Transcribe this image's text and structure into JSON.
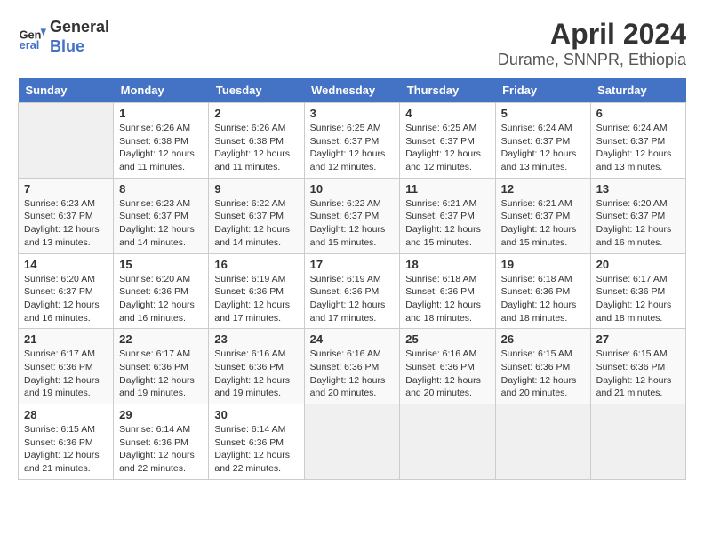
{
  "logo": {
    "line1": "General",
    "line2": "Blue"
  },
  "title": "April 2024",
  "subtitle": "Durame, SNNPR, Ethiopia",
  "days_of_week": [
    "Sunday",
    "Monday",
    "Tuesday",
    "Wednesday",
    "Thursday",
    "Friday",
    "Saturday"
  ],
  "weeks": [
    [
      {
        "num": "",
        "info": ""
      },
      {
        "num": "1",
        "info": "Sunrise: 6:26 AM\nSunset: 6:38 PM\nDaylight: 12 hours\nand 11 minutes."
      },
      {
        "num": "2",
        "info": "Sunrise: 6:26 AM\nSunset: 6:38 PM\nDaylight: 12 hours\nand 11 minutes."
      },
      {
        "num": "3",
        "info": "Sunrise: 6:25 AM\nSunset: 6:37 PM\nDaylight: 12 hours\nand 12 minutes."
      },
      {
        "num": "4",
        "info": "Sunrise: 6:25 AM\nSunset: 6:37 PM\nDaylight: 12 hours\nand 12 minutes."
      },
      {
        "num": "5",
        "info": "Sunrise: 6:24 AM\nSunset: 6:37 PM\nDaylight: 12 hours\nand 13 minutes."
      },
      {
        "num": "6",
        "info": "Sunrise: 6:24 AM\nSunset: 6:37 PM\nDaylight: 12 hours\nand 13 minutes."
      }
    ],
    [
      {
        "num": "7",
        "info": "Sunrise: 6:23 AM\nSunset: 6:37 PM\nDaylight: 12 hours\nand 13 minutes."
      },
      {
        "num": "8",
        "info": "Sunrise: 6:23 AM\nSunset: 6:37 PM\nDaylight: 12 hours\nand 14 minutes."
      },
      {
        "num": "9",
        "info": "Sunrise: 6:22 AM\nSunset: 6:37 PM\nDaylight: 12 hours\nand 14 minutes."
      },
      {
        "num": "10",
        "info": "Sunrise: 6:22 AM\nSunset: 6:37 PM\nDaylight: 12 hours\nand 15 minutes."
      },
      {
        "num": "11",
        "info": "Sunrise: 6:21 AM\nSunset: 6:37 PM\nDaylight: 12 hours\nand 15 minutes."
      },
      {
        "num": "12",
        "info": "Sunrise: 6:21 AM\nSunset: 6:37 PM\nDaylight: 12 hours\nand 15 minutes."
      },
      {
        "num": "13",
        "info": "Sunrise: 6:20 AM\nSunset: 6:37 PM\nDaylight: 12 hours\nand 16 minutes."
      }
    ],
    [
      {
        "num": "14",
        "info": "Sunrise: 6:20 AM\nSunset: 6:37 PM\nDaylight: 12 hours\nand 16 minutes."
      },
      {
        "num": "15",
        "info": "Sunrise: 6:20 AM\nSunset: 6:36 PM\nDaylight: 12 hours\nand 16 minutes."
      },
      {
        "num": "16",
        "info": "Sunrise: 6:19 AM\nSunset: 6:36 PM\nDaylight: 12 hours\nand 17 minutes."
      },
      {
        "num": "17",
        "info": "Sunrise: 6:19 AM\nSunset: 6:36 PM\nDaylight: 12 hours\nand 17 minutes."
      },
      {
        "num": "18",
        "info": "Sunrise: 6:18 AM\nSunset: 6:36 PM\nDaylight: 12 hours\nand 18 minutes."
      },
      {
        "num": "19",
        "info": "Sunrise: 6:18 AM\nSunset: 6:36 PM\nDaylight: 12 hours\nand 18 minutes."
      },
      {
        "num": "20",
        "info": "Sunrise: 6:17 AM\nSunset: 6:36 PM\nDaylight: 12 hours\nand 18 minutes."
      }
    ],
    [
      {
        "num": "21",
        "info": "Sunrise: 6:17 AM\nSunset: 6:36 PM\nDaylight: 12 hours\nand 19 minutes."
      },
      {
        "num": "22",
        "info": "Sunrise: 6:17 AM\nSunset: 6:36 PM\nDaylight: 12 hours\nand 19 minutes."
      },
      {
        "num": "23",
        "info": "Sunrise: 6:16 AM\nSunset: 6:36 PM\nDaylight: 12 hours\nand 19 minutes."
      },
      {
        "num": "24",
        "info": "Sunrise: 6:16 AM\nSunset: 6:36 PM\nDaylight: 12 hours\nand 20 minutes."
      },
      {
        "num": "25",
        "info": "Sunrise: 6:16 AM\nSunset: 6:36 PM\nDaylight: 12 hours\nand 20 minutes."
      },
      {
        "num": "26",
        "info": "Sunrise: 6:15 AM\nSunset: 6:36 PM\nDaylight: 12 hours\nand 20 minutes."
      },
      {
        "num": "27",
        "info": "Sunrise: 6:15 AM\nSunset: 6:36 PM\nDaylight: 12 hours\nand 21 minutes."
      }
    ],
    [
      {
        "num": "28",
        "info": "Sunrise: 6:15 AM\nSunset: 6:36 PM\nDaylight: 12 hours\nand 21 minutes."
      },
      {
        "num": "29",
        "info": "Sunrise: 6:14 AM\nSunset: 6:36 PM\nDaylight: 12 hours\nand 22 minutes."
      },
      {
        "num": "30",
        "info": "Sunrise: 6:14 AM\nSunset: 6:36 PM\nDaylight: 12 hours\nand 22 minutes."
      },
      {
        "num": "",
        "info": ""
      },
      {
        "num": "",
        "info": ""
      },
      {
        "num": "",
        "info": ""
      },
      {
        "num": "",
        "info": ""
      }
    ]
  ]
}
